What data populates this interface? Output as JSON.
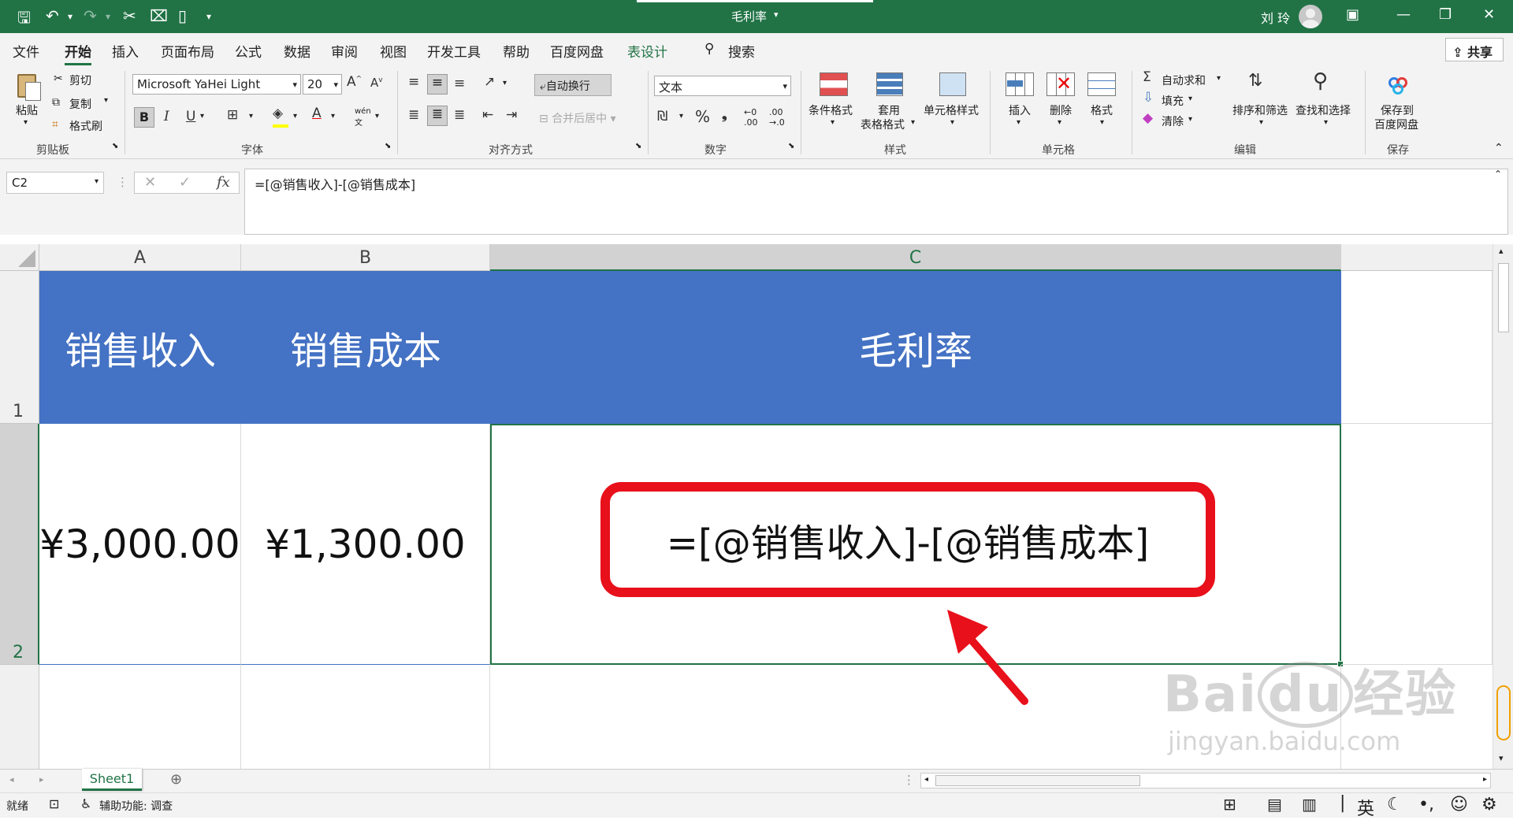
{
  "window": {
    "title": "毛利率",
    "user": "刘 玲"
  },
  "menu": {
    "tabs": [
      "文件",
      "开始",
      "插入",
      "页面布局",
      "公式",
      "数据",
      "审阅",
      "视图",
      "开发工具",
      "帮助",
      "百度网盘",
      "表设计"
    ],
    "search_label": "搜索",
    "share_label": "共享"
  },
  "ribbon": {
    "clipboard": {
      "paste": "粘贴",
      "cut": "剪切",
      "copy": "复制",
      "format_painter": "格式刷",
      "group": "剪贴板"
    },
    "font": {
      "family": "Microsoft YaHei Light",
      "size": "20",
      "group": "字体"
    },
    "alignment": {
      "wrap": "自动换行",
      "merge": "合并后居中",
      "group": "对齐方式"
    },
    "number": {
      "format": "文本",
      "group": "数字"
    },
    "styles": {
      "conditional": "条件格式",
      "table_format_1": "套用",
      "table_format_2": "表格格式",
      "cell_styles": "单元格样式",
      "group": "样式"
    },
    "cells": {
      "insert": "插入",
      "delete": "删除",
      "format": "格式",
      "group": "单元格"
    },
    "editing": {
      "autosum": "自动求和",
      "fill": "填充",
      "clear": "清除",
      "sort_filter": "排序和筛选",
      "find_select": "查找和选择",
      "group": "编辑"
    },
    "save": {
      "label_1": "保存到",
      "label_2": "百度网盘",
      "group": "保存"
    }
  },
  "formula_bar": {
    "name_box": "C2",
    "formula": "=[@销售收入]-[@销售成本]"
  },
  "sheet": {
    "columns": [
      "A",
      "B",
      "C"
    ],
    "rows": [
      "1",
      "2"
    ],
    "headers": [
      "销售收入",
      "销售成本",
      "毛利率"
    ],
    "values": [
      "¥3,000.00",
      "¥1,300.00",
      "=[@销售收入]-[@销售成本]"
    ]
  },
  "sheet_tabs": [
    "Sheet1"
  ],
  "status": {
    "ready": "就绪",
    "accessibility": "辅助功能: 调查",
    "ime": "英"
  },
  "watermark": {
    "logo": "Bai du 经验",
    "url": "jingyan.baidu.com"
  },
  "colors": {
    "excel_green": "#217346",
    "header_fill": "#4472c4",
    "highlight_red": "#e8101a"
  }
}
